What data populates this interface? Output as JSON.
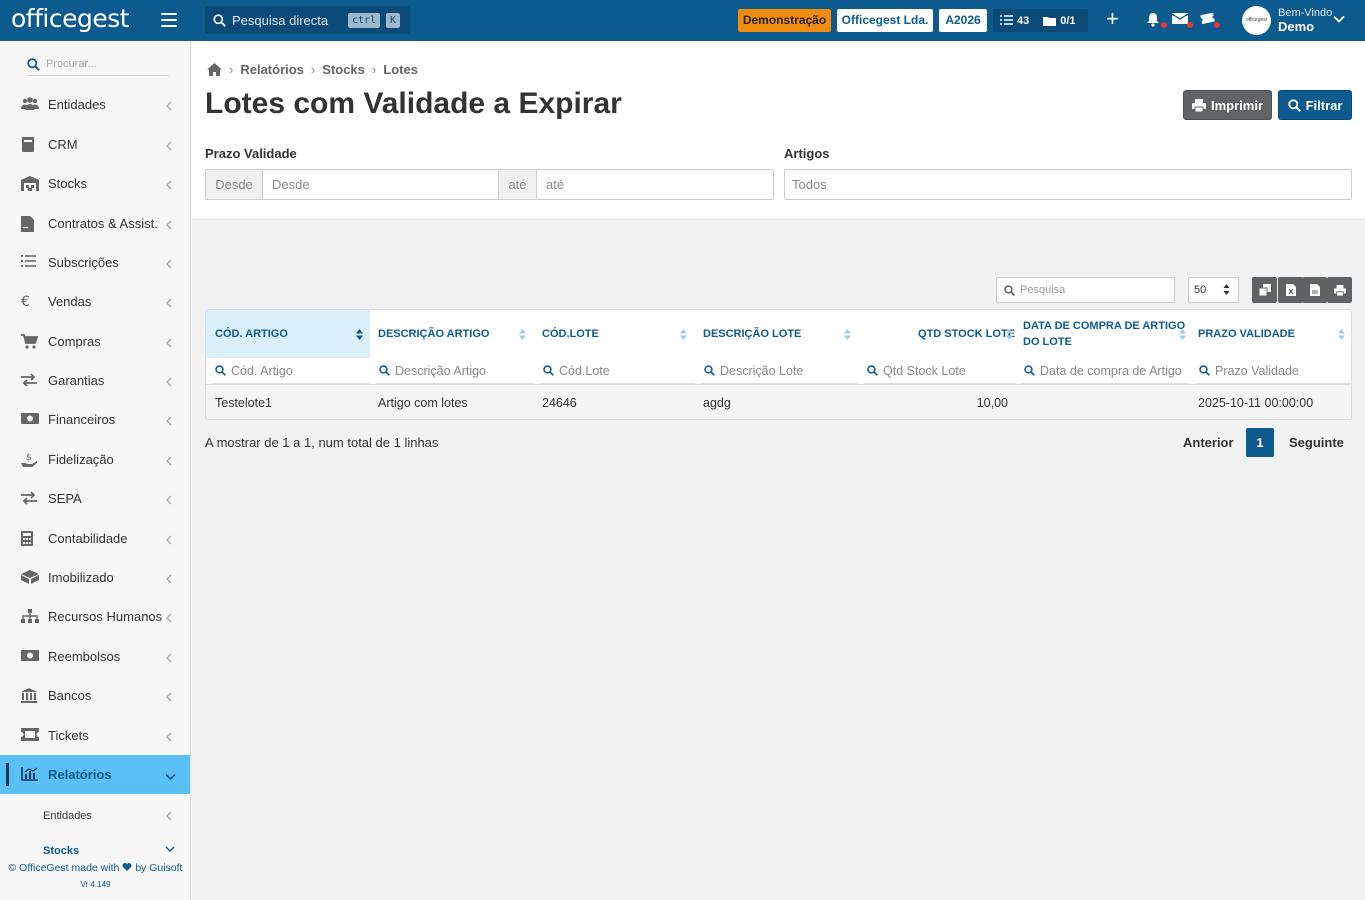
{
  "topbar": {
    "logo": "officegest",
    "search_placeholder": "Pesquisa directa",
    "kbd_ctrl": "ctrl",
    "kbd_k": "K",
    "badge_demo": "Demonstração",
    "badge_company": "Officegest Lda.",
    "badge_year": "A2026",
    "tasks_count": "43",
    "files_count": "0/1",
    "avatar_text": "officegest",
    "welcome": "Bem-Vindo",
    "user": "Demo"
  },
  "sidebar": {
    "search_placeholder": "Procurar...",
    "items": [
      {
        "label": "Entidades",
        "icon": "users-icon"
      },
      {
        "label": "CRM",
        "icon": "book-icon"
      },
      {
        "label": "Stocks",
        "icon": "warehouse-icon"
      },
      {
        "label": "Contratos & Assist.",
        "icon": "file-contract-icon"
      },
      {
        "label": "Subscrições",
        "icon": "list-icon"
      },
      {
        "label": "Vendas",
        "icon": "euro-icon"
      },
      {
        "label": "Compras",
        "icon": "cart-icon"
      },
      {
        "label": "Garantias",
        "icon": "exchange-icon"
      },
      {
        "label": "Financeiros",
        "icon": "money-icon"
      },
      {
        "label": "Fidelização",
        "icon": "hand-dollar-icon"
      },
      {
        "label": "SEPA",
        "icon": "exchange-icon"
      },
      {
        "label": "Contabilidade",
        "icon": "calculator-icon"
      },
      {
        "label": "Imobilizado",
        "icon": "boxes-icon"
      },
      {
        "label": "Recursos Humanos",
        "icon": "sitemap-icon"
      },
      {
        "label": "Reembolsos",
        "icon": "money-icon"
      },
      {
        "label": "Bancos",
        "icon": "bank-icon"
      },
      {
        "label": "Tickets",
        "icon": "ticket-icon"
      },
      {
        "label": "Relatórios",
        "icon": "chart-icon"
      }
    ],
    "sub_items": [
      "Entidades",
      "Stocks"
    ],
    "footer_made": "© OfficeGest made with",
    "footer_by": "by Guisoft",
    "version": "Vr 4.149"
  },
  "breadcrumb": [
    "Relatórios",
    "Stocks",
    "Lotes"
  ],
  "page_title": "Lotes com Validade a Expirar",
  "buttons": {
    "print": "Imprimir",
    "filter": "Filtrar"
  },
  "filters": {
    "validity_label": "Prazo Validade",
    "from_addon": "Desde",
    "from_placeholder": "Desde",
    "to_addon": "até",
    "to_placeholder": "até",
    "articles_label": "Artigos",
    "articles_placeholder": "Todos"
  },
  "table": {
    "search_placeholder": "Pesquisa",
    "page_length": "50",
    "columns": [
      {
        "header": "CÓD. ARTIGO",
        "filter": "Cód. Artigo"
      },
      {
        "header": "DESCRIÇÃO ARTIGO",
        "filter": "Descrição Artigo"
      },
      {
        "header": "CÓD.LOTE",
        "filter": "Cód.Lote"
      },
      {
        "header": "DESCRIÇÃO LOTE",
        "filter": "Descrição Lote"
      },
      {
        "header": "QTD STOCK LOTE",
        "filter": "Qtd Stock Lote"
      },
      {
        "header_line1": "DATA DE COMPRA DE ARTIGO",
        "header_line2": "DO LOTE",
        "filter": "Data de compra de Artigo"
      },
      {
        "header": "PRAZO VALIDADE",
        "filter": "Prazo Validade"
      }
    ],
    "rows": [
      [
        "Testelote1",
        "Artigo com lotes",
        "24646",
        "agdg",
        "10,00",
        "",
        "2025-10-11 00:00:00"
      ]
    ],
    "info": "A mostrar de 1 a 1, num total de 1 linhas",
    "prev": "Anterior",
    "page": "1",
    "next": "Seguinte"
  },
  "colors": {
    "primary": "#0c5a8e",
    "active_nav": "#5bc0f5",
    "demo_badge": "#f08c0f"
  }
}
